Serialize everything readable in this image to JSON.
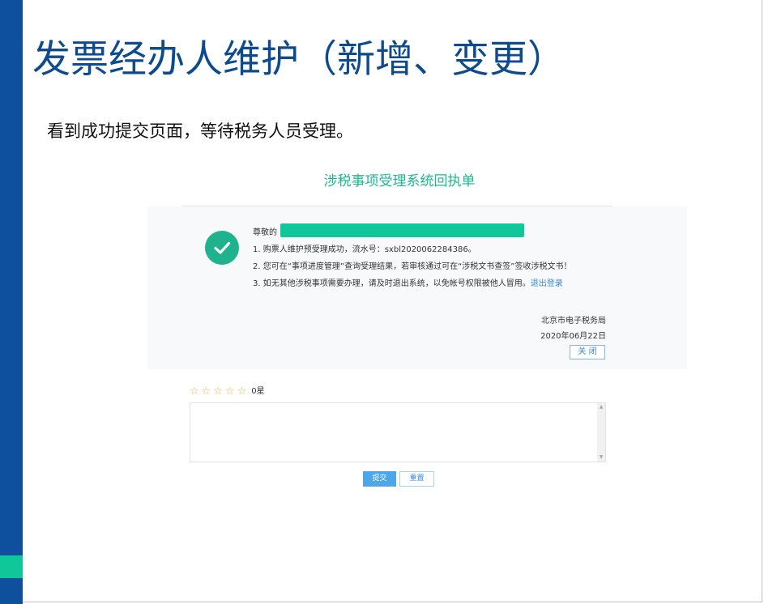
{
  "slide": {
    "title": "发票经办人维护（新增、变更）",
    "subtitle": "看到成功提交页面，等待税务人员受理。",
    "colors": {
      "sidebar": "#0e4f9e",
      "accent": "#10c79a",
      "title": "#0d4a8e"
    }
  },
  "receipt": {
    "title": "涉税事项受理系统回执单",
    "greeting": "尊敬的",
    "status_icon": "check-circle-icon",
    "lines": [
      "1. 购票人维护预受理成功，流水号：sxbl2020062284386。",
      "2. 您可在“事项进度管理”查询受理结果，若审核通过可在“涉税文书查签”签收涉税文书！",
      "3. 如无其他涉税事项需要办理，请及时退出系统，以免帐号权限被他人冒用。"
    ],
    "logout_link": "退出登录",
    "organization": "北京市电子税务局",
    "date": "2020年06月22日",
    "close_label": "关 闭"
  },
  "feedback": {
    "stars": 5,
    "star_icon": "star-outline-icon",
    "rating_text": "0星",
    "comment_value": "",
    "submit_label": "提交",
    "reset_label": "重置"
  }
}
